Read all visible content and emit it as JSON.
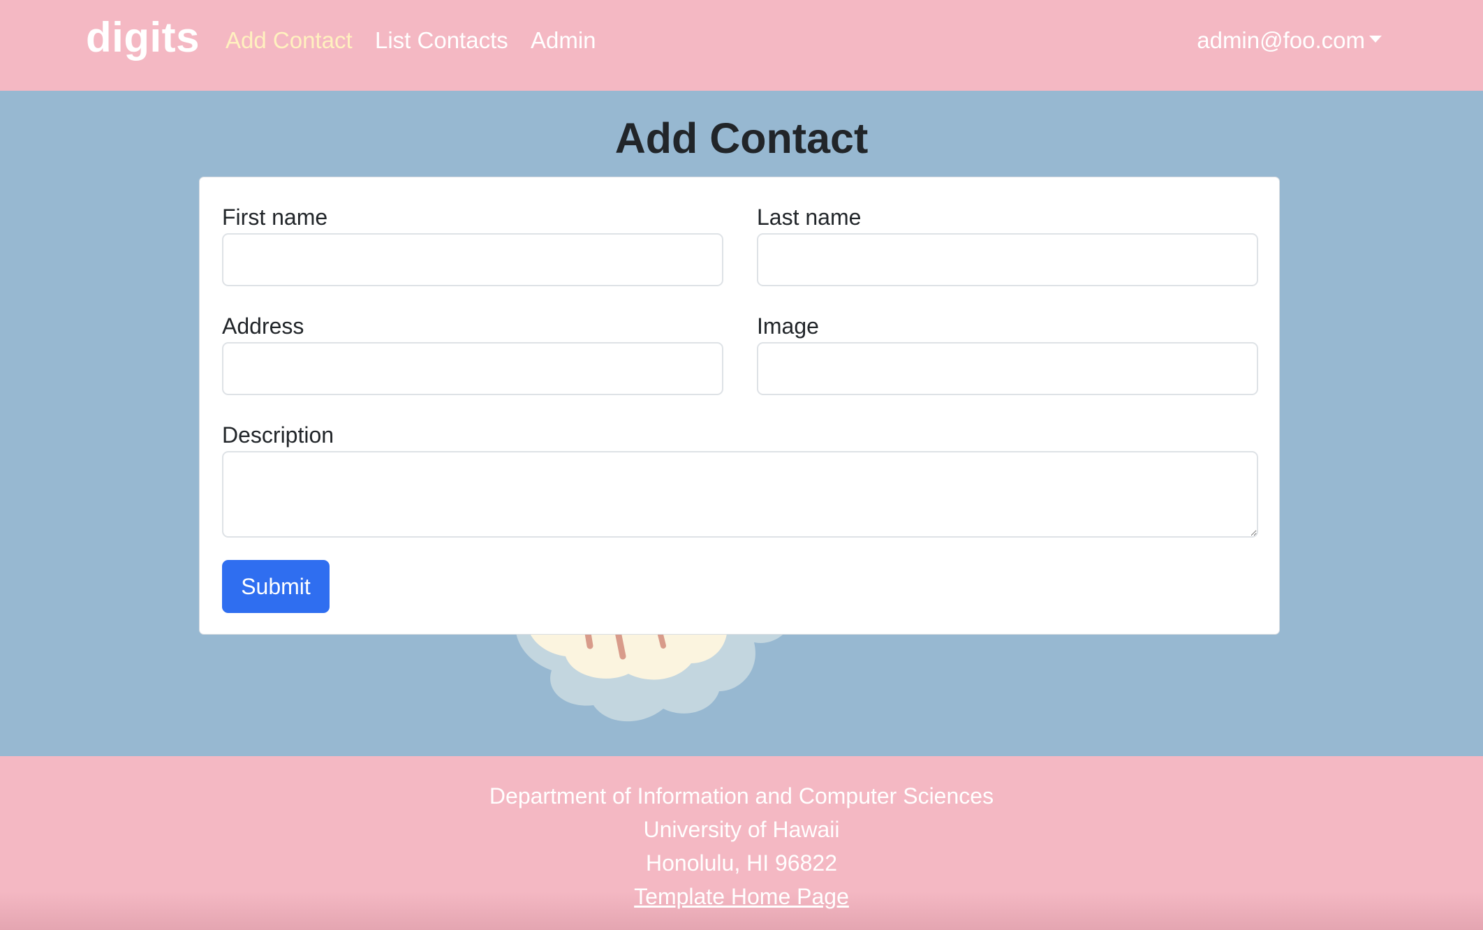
{
  "colors": {
    "navbar_bg": "#f4b8c3",
    "page_bg": "#97b8d1",
    "active_link": "#fff1bf",
    "submit_bg": "#2f6ef0"
  },
  "navbar": {
    "brand": "digits",
    "links": [
      {
        "label": "Add Contact",
        "active": true
      },
      {
        "label": "List Contacts",
        "active": false
      },
      {
        "label": "Admin",
        "active": false
      }
    ],
    "user": "admin@foo.com",
    "user_icon": "caret-down-icon"
  },
  "main": {
    "title": "Add Contact",
    "form": {
      "first_name": {
        "label": "First name",
        "value": ""
      },
      "last_name": {
        "label": "Last name",
        "value": ""
      },
      "address": {
        "label": "Address",
        "value": ""
      },
      "image": {
        "label": "Image",
        "value": ""
      },
      "description": {
        "label": "Description",
        "value": ""
      },
      "submit_label": "Submit"
    }
  },
  "footer": {
    "lines": [
      "Department of Information and Computer Sciences",
      "University of Hawaii",
      "Honolulu, HI 96822"
    ],
    "link_label": "Template Home Page"
  }
}
